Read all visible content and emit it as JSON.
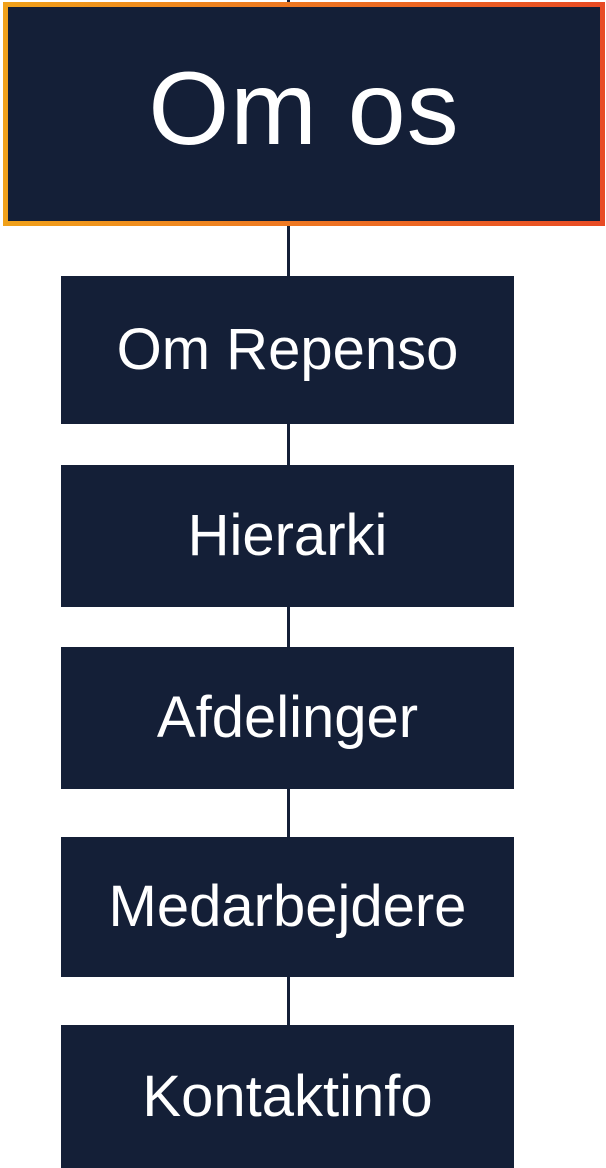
{
  "header": {
    "title": "Om os"
  },
  "menu": {
    "items": [
      {
        "label": "Om Repenso"
      },
      {
        "label": "Hierarki"
      },
      {
        "label": "Afdelinger"
      },
      {
        "label": "Medarbejdere"
      },
      {
        "label": "Kontaktinfo"
      }
    ]
  },
  "colors": {
    "box_fill": "#141f37",
    "header_border_gradient": [
      "#f0a11a",
      "#ee7a21",
      "#e84a24"
    ],
    "text": "#ffffff"
  }
}
